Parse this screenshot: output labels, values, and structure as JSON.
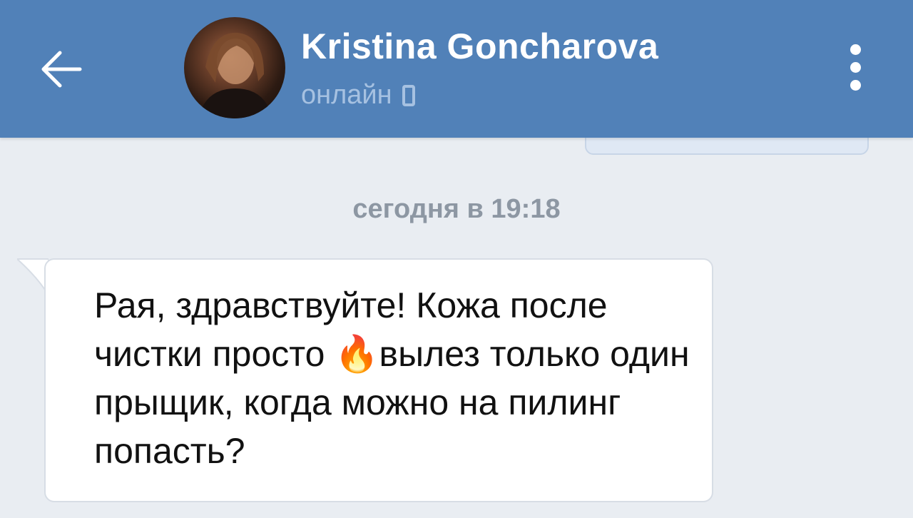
{
  "header": {
    "contact_name": "Kristina Goncharova",
    "status": "онлайн",
    "back_icon": "arrow-left-icon",
    "status_icon": "phone-icon",
    "menu_icon": "kebab-menu-icon"
  },
  "chat": {
    "date_separator": "сегодня в 19:18",
    "messages": [
      {
        "direction": "incoming",
        "text": "Рая, здравствуйте! Кожа после чистки просто 🔥вылез только один прыщик, когда можно на пилинг попасть?"
      }
    ]
  },
  "colors": {
    "header_bg": "#5181b8",
    "chat_bg": "#e9edf2",
    "status_text": "#a6c1e1",
    "outgoing_bubble": "#dfe8f4",
    "incoming_bubble": "#ffffff"
  }
}
